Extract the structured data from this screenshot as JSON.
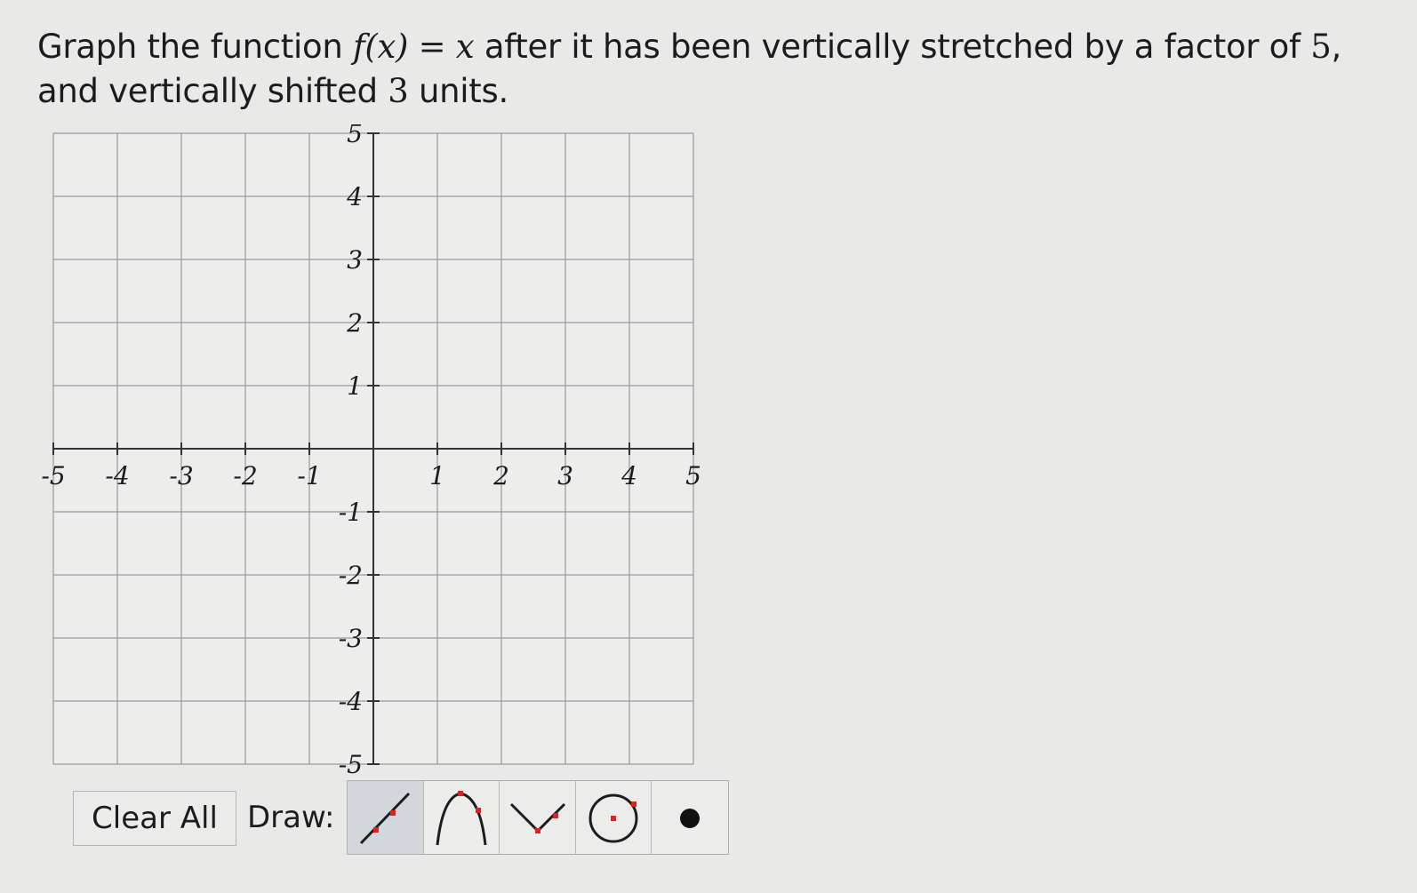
{
  "question": {
    "prefix": "Graph the function ",
    "function": "f(x) = x",
    "middle": " after it has been vertically stretched by a factor of ",
    "stretch_factor": "5",
    "middle2": ", and vertically shifted ",
    "shift": "3",
    "suffix": " units."
  },
  "graph": {
    "x_tick_labels": [
      "-5",
      "-4",
      "-3",
      "-2",
      "-1",
      "1",
      "2",
      "3",
      "4",
      "5"
    ],
    "y_tick_labels": [
      "5",
      "4",
      "3",
      "2",
      "1",
      "-1",
      "-2",
      "-3",
      "-4",
      "-5"
    ],
    "xlim": [
      -5,
      5
    ],
    "ylim": [
      -5,
      5
    ],
    "grid": true,
    "colors": {
      "grid": "#9a9a9a",
      "axis": "#333333",
      "point": "#e02020"
    }
  },
  "controls": {
    "clear_label": "Clear All",
    "draw_label": "Draw:",
    "tools": [
      {
        "icon": "line-tool-icon",
        "active": true
      },
      {
        "icon": "parabola-down-tool-icon",
        "active": false
      },
      {
        "icon": "absolute-value-tool-icon",
        "active": false
      },
      {
        "icon": "circle-tool-icon",
        "active": false
      },
      {
        "icon": "point-tool-icon",
        "active": false
      }
    ]
  }
}
